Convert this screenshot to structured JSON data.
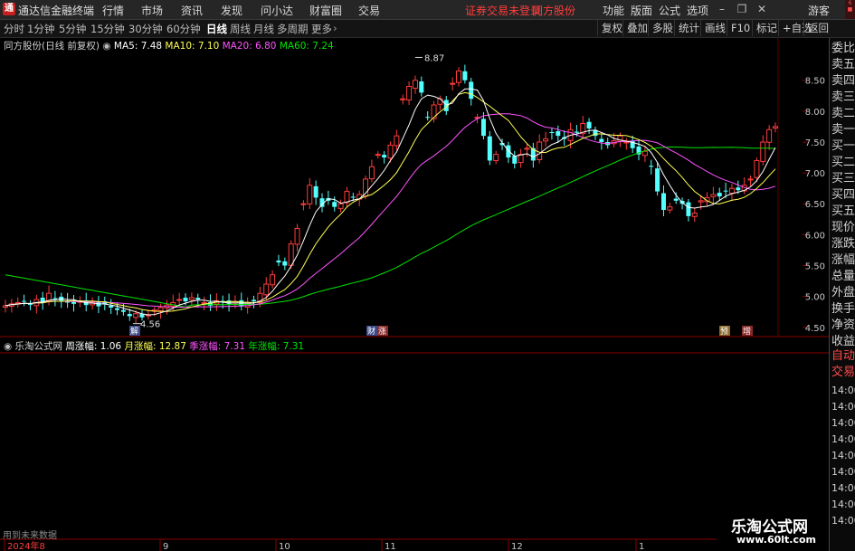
{
  "titlebar": {
    "app_title": "通达信金融终端",
    "menus": [
      "行情",
      "市场",
      "资讯",
      "发现",
      "问小达",
      "财富圈",
      "交易"
    ],
    "status": "证券交易未登录",
    "stock": "同方股份",
    "right_menus": [
      "功能",
      "版面",
      "公式",
      "选项"
    ],
    "guest": "游客"
  },
  "periods": [
    "分时",
    "1分钟",
    "5分钟",
    "15分钟",
    "30分钟",
    "60分钟",
    "日线",
    "周线",
    "月线",
    "多周期",
    "更多"
  ],
  "active_period": "日线",
  "tools": [
    "复权",
    "叠加",
    "多股",
    "统计",
    "画线",
    "F10",
    "标记",
    "+自选",
    "返回"
  ],
  "main_legend": {
    "name": "同方股份(日线 前复权)",
    "ma5": "MA5: 7.48",
    "ma10": "MA10: 7.10",
    "ma20": "MA20: 6.80",
    "ma60": "MA60: 7.24"
  },
  "lower_legend": {
    "name": "乐淘公式网",
    "week": "周涨幅: 1.06",
    "month": "月涨幅: 12.87",
    "season": "季涨幅: 7.31",
    "year": "年涨幅: 7.31"
  },
  "price_axis": [
    "8.50",
    "8.00",
    "7.50",
    "7.00",
    "6.50",
    "6.00",
    "5.50",
    "5.00",
    "4.50"
  ],
  "annotations": {
    "high": "8.87",
    "low": "4.56",
    "tag1": "解",
    "tag2": "财",
    "tag3": "涨",
    "tag4": "预",
    "tag5": "增"
  },
  "time_axis": [
    "2024年8",
    "9",
    "10",
    "11",
    "12",
    "1"
  ],
  "right_panel": [
    "委比",
    "卖五",
    "卖四",
    "卖三",
    "卖二",
    "卖一",
    "买一",
    "买二",
    "买三",
    "买四",
    "买五",
    "现价",
    "涨跌",
    "涨幅",
    "总量",
    "外盘",
    "换手",
    "净资",
    "收益",
    "自动",
    "交易",
    "14:00",
    "14:00",
    "14:00",
    "14:00",
    "14:00",
    "14:00",
    "14:00",
    "14:00",
    "14:00"
  ],
  "bottom_text": "用到未来数据",
  "watermark": {
    "line1": "乐淘公式网",
    "line2": "www.60lt.com"
  },
  "colors": {
    "up": "#ff3c3c",
    "down": "#54ffff",
    "ma5": "#ffffff",
    "ma10": "#ffff54",
    "ma20": "#ff54ff",
    "ma60": "#00e600"
  }
}
